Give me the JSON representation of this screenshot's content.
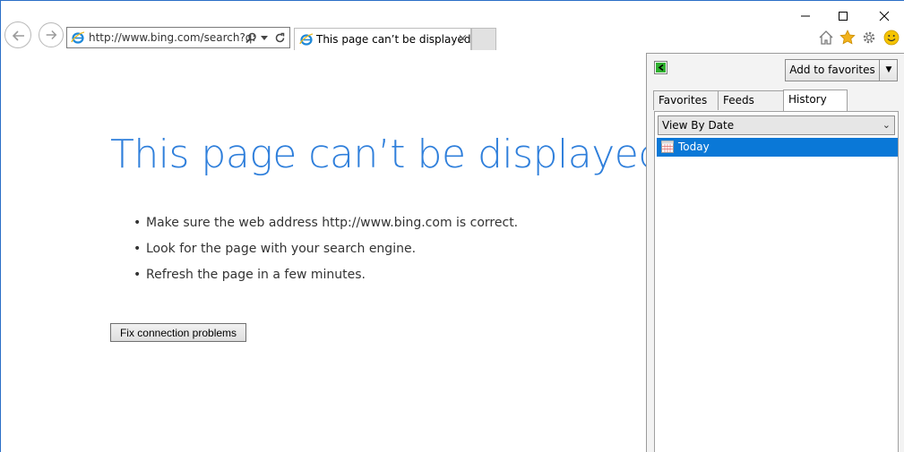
{
  "browser": {
    "address_url": "http://www.bing.com/search?q:",
    "tab_title": "This page can’t be displayed",
    "tab_close": "×"
  },
  "error_page": {
    "title": "This page can’t be displayed",
    "bullets": [
      "Make sure the web address http://www.bing.com is correct.",
      "Look for the page with your search engine.",
      "Refresh the page in a few minutes."
    ],
    "bullet_char": "•",
    "fix_button_label": "Fix connection problems"
  },
  "favorites_panel": {
    "add_to_favorites_label": "Add to favorites",
    "tabs": [
      {
        "label": "Favorites",
        "active": false
      },
      {
        "label": "Feeds",
        "active": false
      },
      {
        "label": "History",
        "active": true
      }
    ],
    "view_option": "View By Date",
    "history_items": [
      {
        "label": "Today",
        "selected": true
      }
    ]
  },
  "colors": {
    "accent_blue": "#2f7fdb",
    "selection_blue": "#0a78d7",
    "favorites_star": "#f2b21b",
    "smiley": "#f5c400"
  }
}
